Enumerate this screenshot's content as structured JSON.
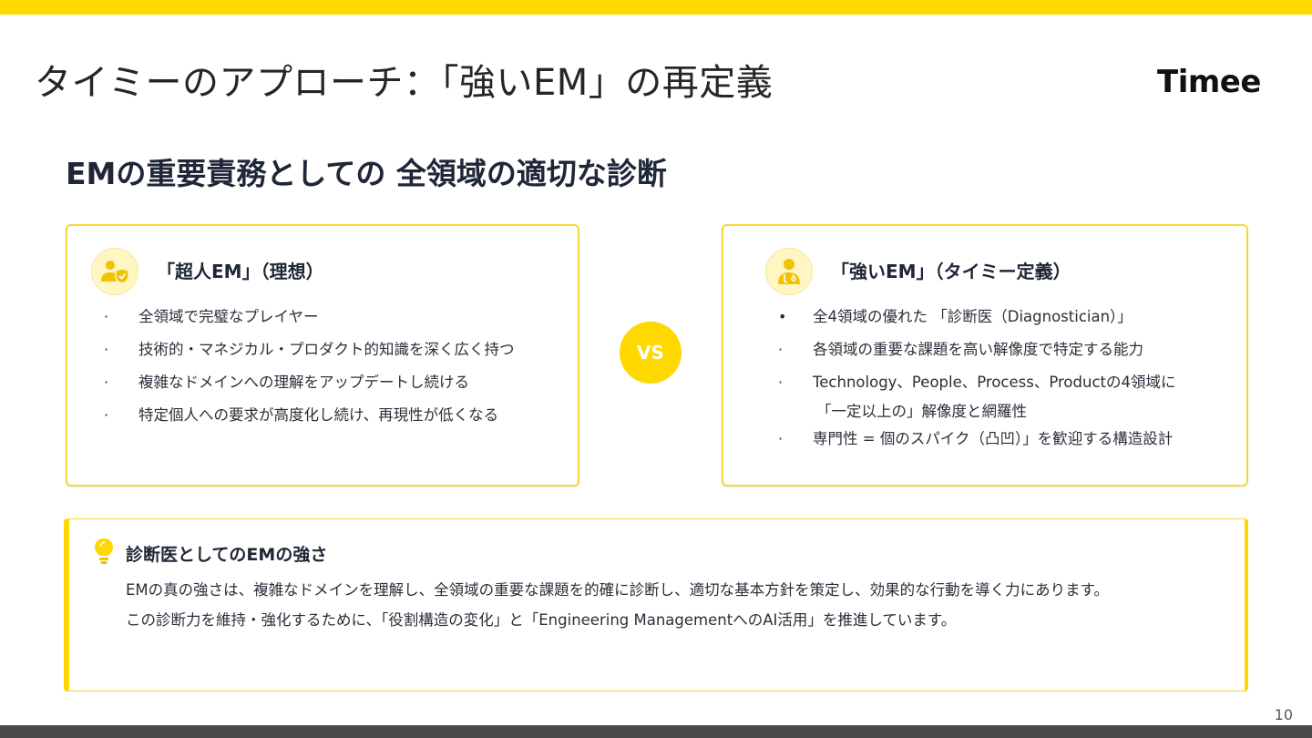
{
  "slide": {
    "title": "タイミーのアプローチ：「強いEM」の再定義",
    "logo": "Timee",
    "subtitle": "EMの重要責務としての 全領域の適切な診断",
    "page_number": "10"
  },
  "left_card": {
    "title": "「超人EM」（理想）",
    "icon": "person-shield-icon",
    "items": [
      "全領域で完璧なプレイヤー",
      "技術的・マネジカル・プロダクト的知識を深く広く持つ",
      "複雑なドメインへの理解をアップデートし続ける",
      "特定個人への要求が高度化し続け、再現性が低くなる"
    ]
  },
  "vs_label": "VS",
  "right_card": {
    "title": "「強いEM」（タイミー定義）",
    "icon": "doctor-icon",
    "items": [
      "全4領域の優れた 「診断医（Diagnostician）」",
      "各領域の重要な課題を高い解像度で特定する能力",
      "Technology、People、Process、Productの4領域に",
      "「一定以上の」解像度と網羅性",
      "専門性 = 個のスパイク（凸凹）」を歓迎する構造設計"
    ]
  },
  "bottom_card": {
    "icon": "lightbulb-icon",
    "title": "診断医としてのEMの強さ",
    "line1": "EMの真の強さは、複雑なドメインを理解し、全領域の重要な課題を的確に診断し、適切な基本方針を策定し、効果的な行動を導く力にあります。",
    "line2": "この診断力を維持・強化するために、「役割構造の変化」と「Engineering ManagementへのAI活用」を推進しています。"
  },
  "colors": {
    "accent": "#ffd800",
    "border": "#f5d83a",
    "footer": "#4a4a4a"
  }
}
